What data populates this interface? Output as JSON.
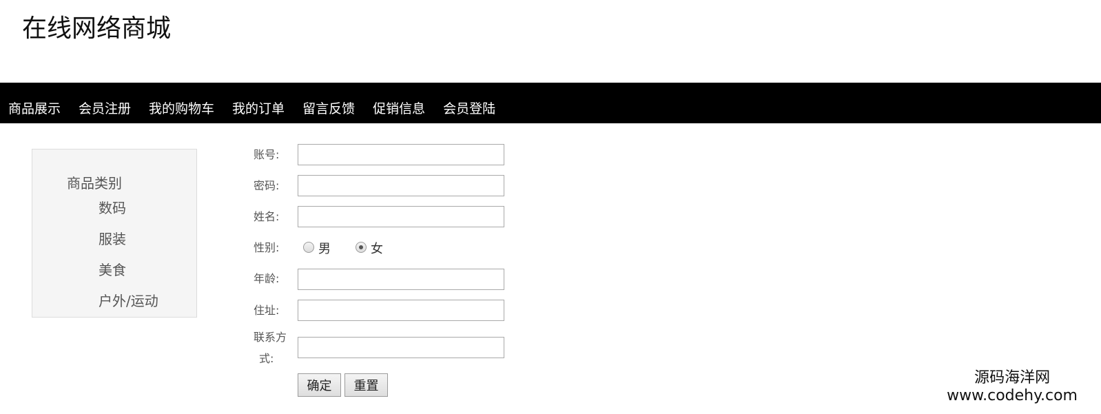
{
  "header": {
    "site_title": "在线网络商城"
  },
  "nav": {
    "items": [
      "商品展示",
      "会员注册",
      "我的购物车",
      "我的订单",
      "留言反馈",
      "促销信息",
      "会员登陆"
    ]
  },
  "sidebar": {
    "title": "商品类别",
    "categories": [
      "数码",
      "服装",
      "美食",
      "户外/运动"
    ]
  },
  "form": {
    "account_label": "账号:",
    "account_value": "",
    "password_label": "密码:",
    "password_value": "",
    "name_label": "姓名:",
    "name_value": "",
    "gender_label": "性别:",
    "gender_options": [
      "男",
      "女"
    ],
    "gender_selected": "女",
    "age_label": "年龄:",
    "age_value": "",
    "address_label": "住址:",
    "address_value": "",
    "contact_label_line1": "联系方",
    "contact_label_line2": "式:",
    "contact_value": "",
    "submit_label": "确定",
    "reset_label": "重置"
  },
  "watermark": {
    "name": "源码海洋网",
    "url": "www.codehy.com"
  }
}
